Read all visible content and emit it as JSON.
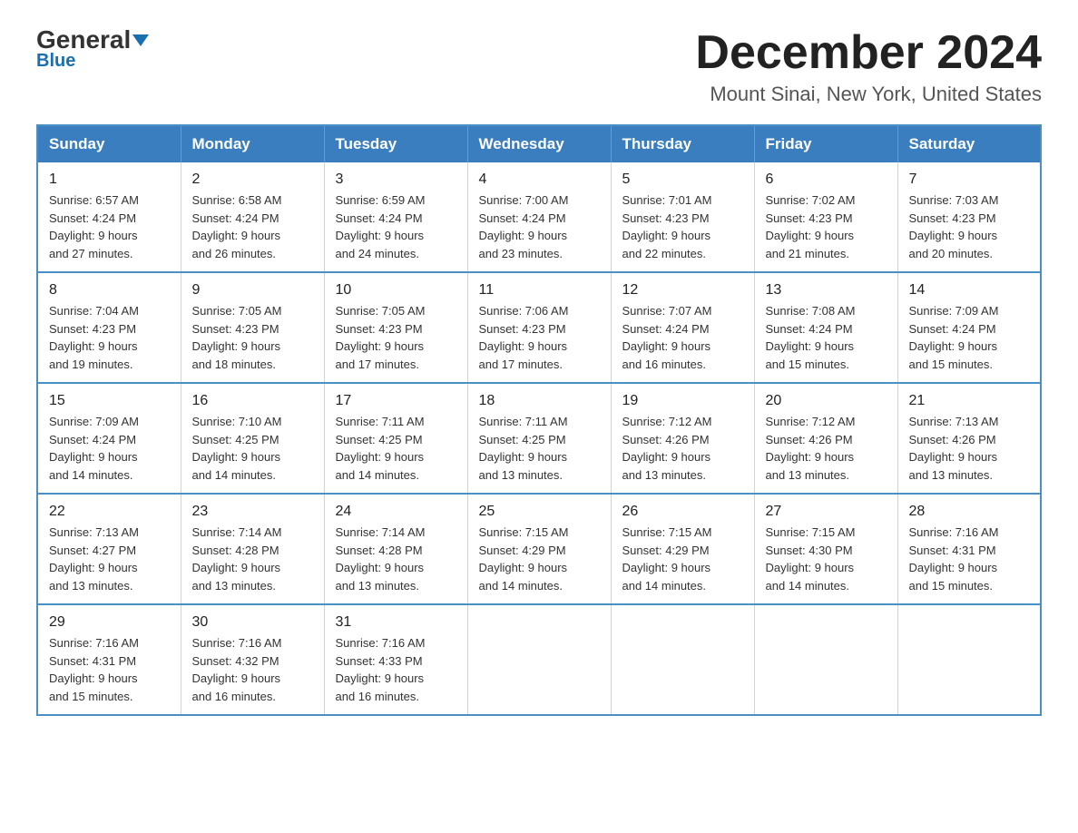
{
  "header": {
    "logo_main": "General",
    "logo_sub": "Blue",
    "month": "December 2024",
    "location": "Mount Sinai, New York, United States"
  },
  "days_of_week": [
    "Sunday",
    "Monday",
    "Tuesday",
    "Wednesday",
    "Thursday",
    "Friday",
    "Saturday"
  ],
  "weeks": [
    [
      {
        "day": "1",
        "sunrise": "6:57 AM",
        "sunset": "4:24 PM",
        "daylight": "9 hours and 27 minutes."
      },
      {
        "day": "2",
        "sunrise": "6:58 AM",
        "sunset": "4:24 PM",
        "daylight": "9 hours and 26 minutes."
      },
      {
        "day": "3",
        "sunrise": "6:59 AM",
        "sunset": "4:24 PM",
        "daylight": "9 hours and 24 minutes."
      },
      {
        "day": "4",
        "sunrise": "7:00 AM",
        "sunset": "4:24 PM",
        "daylight": "9 hours and 23 minutes."
      },
      {
        "day": "5",
        "sunrise": "7:01 AM",
        "sunset": "4:23 PM",
        "daylight": "9 hours and 22 minutes."
      },
      {
        "day": "6",
        "sunrise": "7:02 AM",
        "sunset": "4:23 PM",
        "daylight": "9 hours and 21 minutes."
      },
      {
        "day": "7",
        "sunrise": "7:03 AM",
        "sunset": "4:23 PM",
        "daylight": "9 hours and 20 minutes."
      }
    ],
    [
      {
        "day": "8",
        "sunrise": "7:04 AM",
        "sunset": "4:23 PM",
        "daylight": "9 hours and 19 minutes."
      },
      {
        "day": "9",
        "sunrise": "7:05 AM",
        "sunset": "4:23 PM",
        "daylight": "9 hours and 18 minutes."
      },
      {
        "day": "10",
        "sunrise": "7:05 AM",
        "sunset": "4:23 PM",
        "daylight": "9 hours and 17 minutes."
      },
      {
        "day": "11",
        "sunrise": "7:06 AM",
        "sunset": "4:23 PM",
        "daylight": "9 hours and 17 minutes."
      },
      {
        "day": "12",
        "sunrise": "7:07 AM",
        "sunset": "4:24 PM",
        "daylight": "9 hours and 16 minutes."
      },
      {
        "day": "13",
        "sunrise": "7:08 AM",
        "sunset": "4:24 PM",
        "daylight": "9 hours and 15 minutes."
      },
      {
        "day": "14",
        "sunrise": "7:09 AM",
        "sunset": "4:24 PM",
        "daylight": "9 hours and 15 minutes."
      }
    ],
    [
      {
        "day": "15",
        "sunrise": "7:09 AM",
        "sunset": "4:24 PM",
        "daylight": "9 hours and 14 minutes."
      },
      {
        "day": "16",
        "sunrise": "7:10 AM",
        "sunset": "4:25 PM",
        "daylight": "9 hours and 14 minutes."
      },
      {
        "day": "17",
        "sunrise": "7:11 AM",
        "sunset": "4:25 PM",
        "daylight": "9 hours and 14 minutes."
      },
      {
        "day": "18",
        "sunrise": "7:11 AM",
        "sunset": "4:25 PM",
        "daylight": "9 hours and 13 minutes."
      },
      {
        "day": "19",
        "sunrise": "7:12 AM",
        "sunset": "4:26 PM",
        "daylight": "9 hours and 13 minutes."
      },
      {
        "day": "20",
        "sunrise": "7:12 AM",
        "sunset": "4:26 PM",
        "daylight": "9 hours and 13 minutes."
      },
      {
        "day": "21",
        "sunrise": "7:13 AM",
        "sunset": "4:26 PM",
        "daylight": "9 hours and 13 minutes."
      }
    ],
    [
      {
        "day": "22",
        "sunrise": "7:13 AM",
        "sunset": "4:27 PM",
        "daylight": "9 hours and 13 minutes."
      },
      {
        "day": "23",
        "sunrise": "7:14 AM",
        "sunset": "4:28 PM",
        "daylight": "9 hours and 13 minutes."
      },
      {
        "day": "24",
        "sunrise": "7:14 AM",
        "sunset": "4:28 PM",
        "daylight": "9 hours and 13 minutes."
      },
      {
        "day": "25",
        "sunrise": "7:15 AM",
        "sunset": "4:29 PM",
        "daylight": "9 hours and 14 minutes."
      },
      {
        "day": "26",
        "sunrise": "7:15 AM",
        "sunset": "4:29 PM",
        "daylight": "9 hours and 14 minutes."
      },
      {
        "day": "27",
        "sunrise": "7:15 AM",
        "sunset": "4:30 PM",
        "daylight": "9 hours and 14 minutes."
      },
      {
        "day": "28",
        "sunrise": "7:16 AM",
        "sunset": "4:31 PM",
        "daylight": "9 hours and 15 minutes."
      }
    ],
    [
      {
        "day": "29",
        "sunrise": "7:16 AM",
        "sunset": "4:31 PM",
        "daylight": "9 hours and 15 minutes."
      },
      {
        "day": "30",
        "sunrise": "7:16 AM",
        "sunset": "4:32 PM",
        "daylight": "9 hours and 16 minutes."
      },
      {
        "day": "31",
        "sunrise": "7:16 AM",
        "sunset": "4:33 PM",
        "daylight": "9 hours and 16 minutes."
      },
      null,
      null,
      null,
      null
    ]
  ]
}
